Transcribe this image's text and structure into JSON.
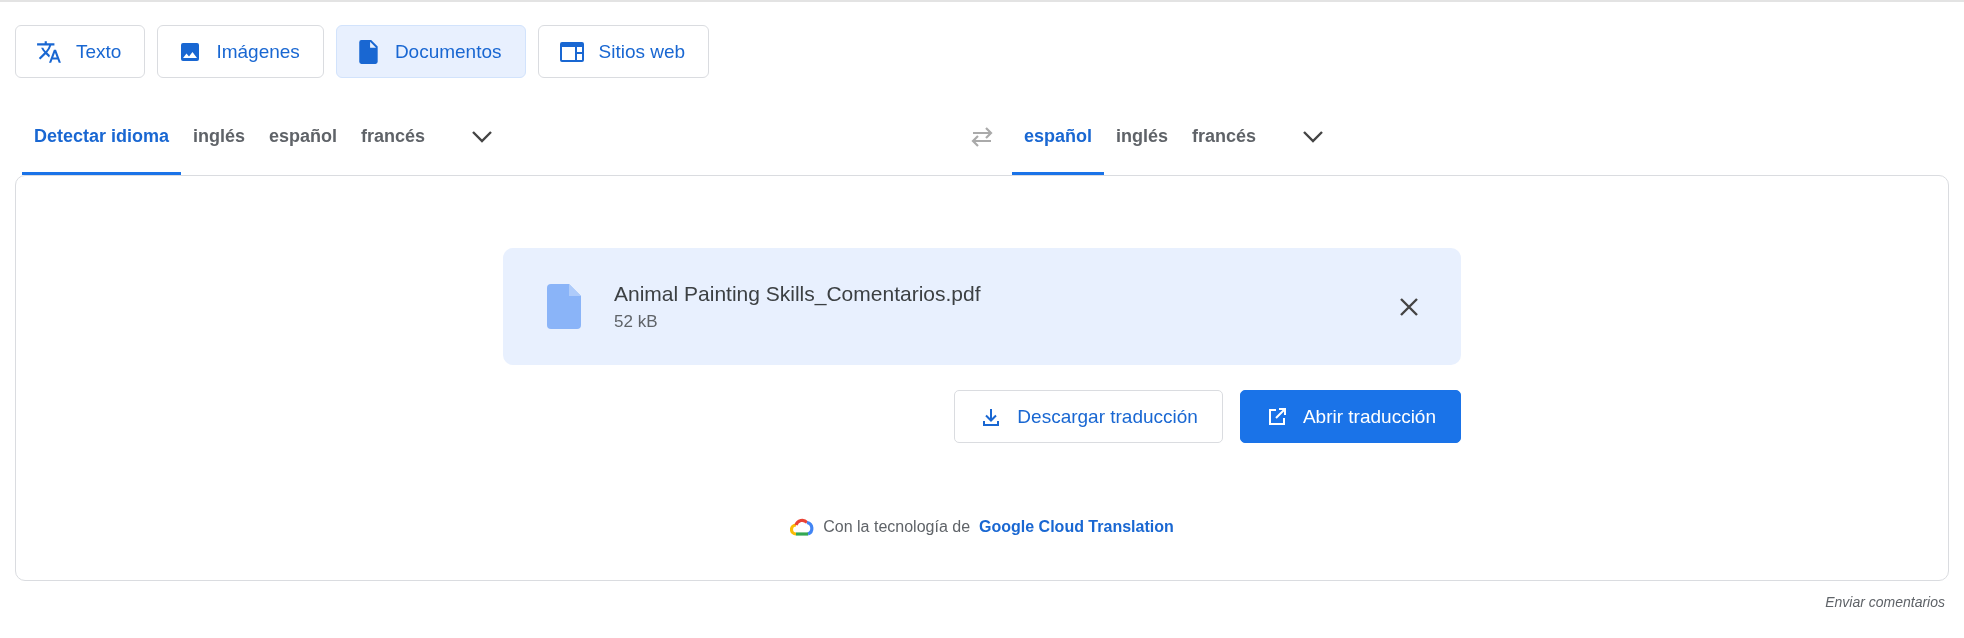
{
  "modes": [
    {
      "label": "Texto",
      "kind": "text",
      "selected": false
    },
    {
      "label": "Imágenes",
      "kind": "image",
      "selected": false
    },
    {
      "label": "Documentos",
      "kind": "document",
      "selected": true
    },
    {
      "label": "Sitios web",
      "kind": "website",
      "selected": false
    }
  ],
  "source_languages": [
    {
      "label": "Detectar idioma",
      "selected": true
    },
    {
      "label": "inglés",
      "selected": false
    },
    {
      "label": "español",
      "selected": false
    },
    {
      "label": "francés",
      "selected": false
    }
  ],
  "target_languages": [
    {
      "label": "español",
      "selected": true
    },
    {
      "label": "inglés",
      "selected": false
    },
    {
      "label": "francés",
      "selected": false
    }
  ],
  "file": {
    "name": "Animal Painting Skills_Comentarios.pdf",
    "size": "52 kB"
  },
  "actions": [
    {
      "label": "Descargar traducción",
      "kind": "download"
    },
    {
      "label": "Abrir traducción",
      "kind": "open"
    }
  ],
  "footer": {
    "prefix": "Con la tecnología de",
    "link": "Google Cloud Translation"
  },
  "feedback": "Enviar comentarios"
}
